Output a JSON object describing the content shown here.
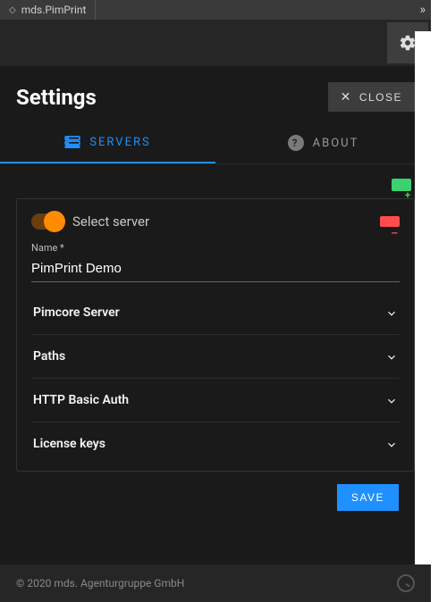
{
  "titlebar": {
    "tab_name": "mds.PimPrint"
  },
  "header": {
    "title": "Settings",
    "close_label": "CLOSE"
  },
  "tabs": {
    "servers_label": "SERVERS",
    "about_label": "ABOUT"
  },
  "panel": {
    "toggle_label": "Select server",
    "name_label": "Name *",
    "name_value": "PimPrint Demo",
    "sections": {
      "pimcore": "Pimcore Server",
      "paths": "Paths",
      "http_auth": "HTTP Basic Auth",
      "license": "License keys"
    },
    "save_label": "SAVE"
  },
  "footer": {
    "copyright": "© 2020 mds. Agenturgruppe GmbH"
  }
}
